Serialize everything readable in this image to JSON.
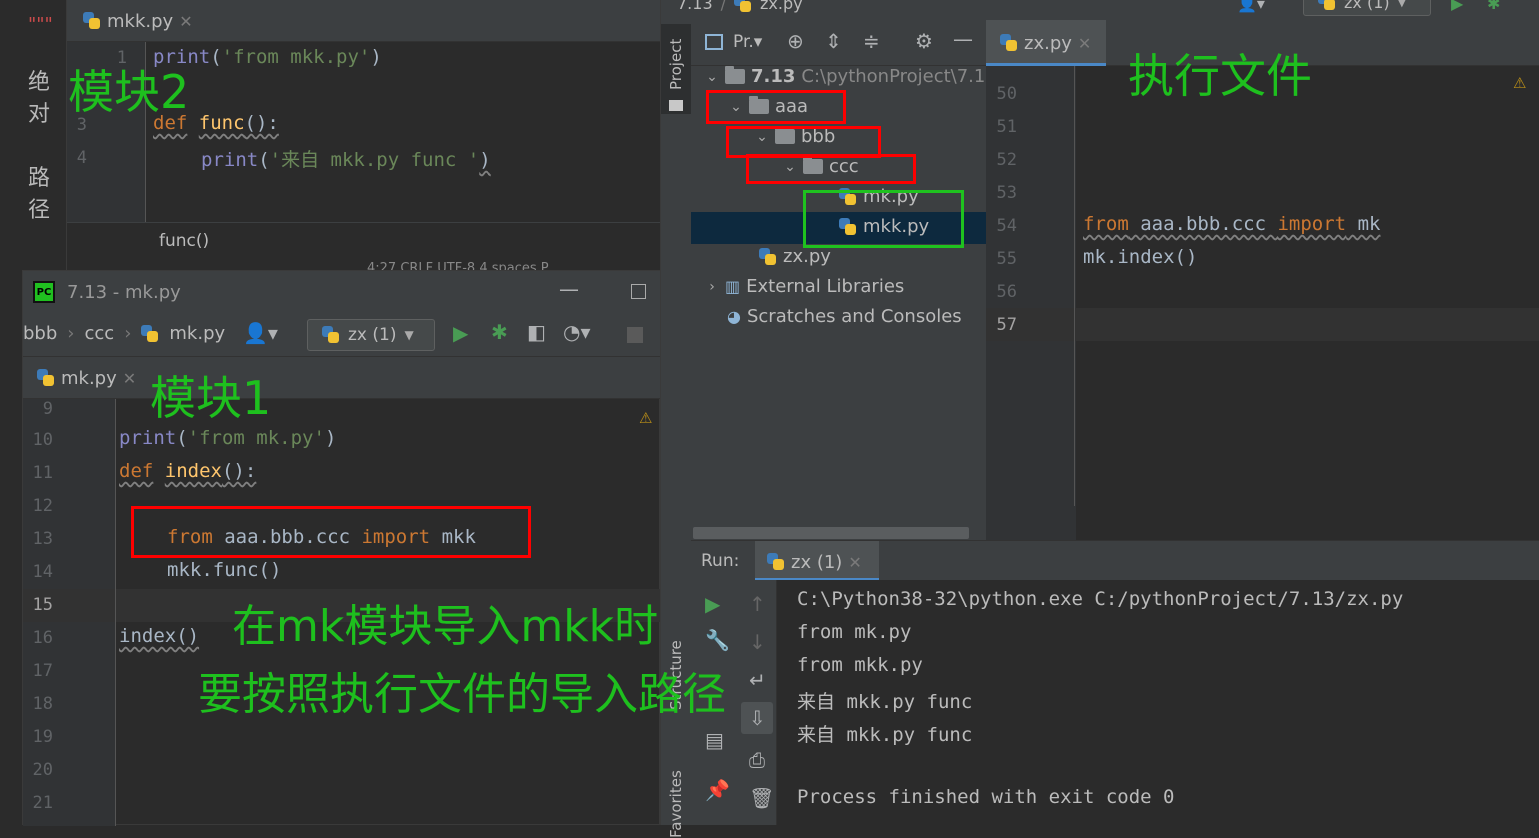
{
  "bgdoc": {
    "lines": [
      "\"\"\"",
      "绝对",
      "路径"
    ]
  },
  "w1": {
    "tab": "mkk.py",
    "line_numbers": [
      "1",
      "3",
      "4"
    ],
    "code": {
      "l1_fn": "print",
      "l1_str": "'from mkk.py'",
      "l3_kw": "def",
      "l3_fn": "func",
      "l3_rest": "():",
      "l4_fn": "print",
      "l4_str": "'来自 mkk.py func '",
      "l4_close": ")"
    },
    "breadcrumb": "func()",
    "status": "4:27  CRLF  UTF-8  4 spaces  P"
  },
  "w2": {
    "title": "7.13 - mk.py",
    "nav": {
      "crumb1": "bbb",
      "crumb2": "ccc",
      "crumb3": "mk.py",
      "run_config": "zx (1)"
    },
    "tab": "mk.py",
    "line_numbers": [
      "9",
      "10",
      "11",
      "12",
      "13",
      "14",
      "15",
      "16",
      "17",
      "18",
      "19",
      "20",
      "21"
    ],
    "code": {
      "l10_fn": "print",
      "l10_str": "'from mk.py'",
      "l10_close": ")",
      "l11_kw": "def",
      "l11_fn": "index",
      "l11_rest": "():",
      "l13_kw1": "from",
      "l13_mod": " aaa.bbb.ccc ",
      "l13_kw2": "import",
      "l13_name": " mkk",
      "l14": "mkk.func()",
      "l16": "index()"
    }
  },
  "w3": {
    "topnav": {
      "crumb1": "7.13",
      "crumb2": "zx.py",
      "run_config": "zx (1)"
    },
    "side_tabs": {
      "project": "Project",
      "structure": "Structure",
      "favorites": "Favorites"
    },
    "proj_toolbar_label": "Pr.",
    "tree": {
      "root": "7.13",
      "root_path": "C:\\pythonProject\\7.1",
      "aaa": "aaa",
      "bbb": "bbb",
      "ccc": "ccc",
      "mk": "mk.py",
      "mkk": "mkk.py",
      "zx": "zx.py",
      "ext": "External Libraries",
      "scratch": "Scratches and Consoles"
    },
    "editor_tab": "zx.py",
    "line_numbers": [
      "50",
      "51",
      "52",
      "53",
      "54",
      "55",
      "56",
      "57"
    ],
    "code": {
      "l54_kw1": "from",
      "l54_mod": " aaa.bbb.ccc ",
      "l54_kw2": "import",
      "l54_name": " mk",
      "l55": "mk.index()"
    },
    "run": {
      "label": "Run:",
      "tab": "zx (1)",
      "output": [
        "C:\\Python38-32\\python.exe C:/pythonProject/7.13/zx.py",
        "from mk.py",
        "from mkk.py",
        "来自 mkk.py func",
        "来自 mkk.py func",
        "",
        "Process finished with exit code 0"
      ]
    }
  },
  "annotations": {
    "module2": "模块2",
    "module1": "模块1",
    "exec_file": "执行文件",
    "note1": "在mk模块导入mkk时",
    "note2": "要按照执行文件的导入路径"
  },
  "colors": {
    "annotation": "#1ec01e",
    "red_box": "#ff0000",
    "green_box": "#1fc21f",
    "keyword": "#cc7832",
    "string": "#6a8759"
  }
}
